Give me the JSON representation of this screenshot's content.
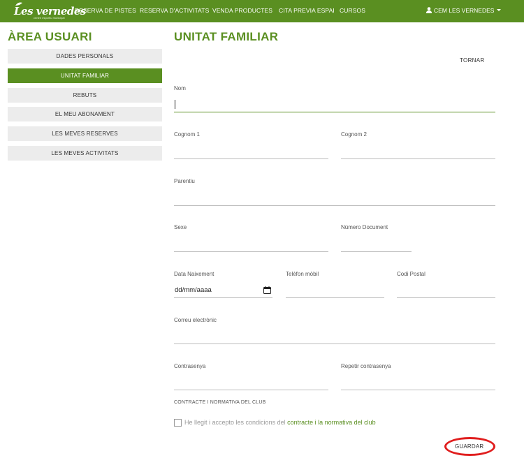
{
  "brand": {
    "name": "Les vernedes",
    "tagline": "centre esportiu municipal"
  },
  "nav": {
    "items": [
      {
        "label": "RESERVA DE PISTES"
      },
      {
        "label": "RESERVA D'ACTIVITATS"
      },
      {
        "label": "VENDA PRODUCTES"
      },
      {
        "label": "CITA PREVIA ESPAI"
      },
      {
        "label": "CURSOS"
      }
    ],
    "user": {
      "label": "CEM LES VERNEDES",
      "icon": "user-icon"
    }
  },
  "sidebar": {
    "title": "ÀREA USUARI",
    "items": [
      {
        "label": "DADES PERSONALS",
        "active": false
      },
      {
        "label": "UNITAT FAMILIAR",
        "active": true
      },
      {
        "label": "REBUTS",
        "active": false
      },
      {
        "label": "EL MEU ABONAMENT",
        "active": false
      },
      {
        "label": "LES MEVES RESERVES",
        "active": false
      },
      {
        "label": "LES MEVES ACTIVITATS",
        "active": false
      }
    ]
  },
  "main": {
    "title": "UNITAT FAMILIAR",
    "back_label": "TORNAR",
    "fields": {
      "nom": {
        "label": "Nom",
        "value": ""
      },
      "cognom1": {
        "label": "Cognom 1",
        "value": ""
      },
      "cognom2": {
        "label": "Cognom 2",
        "value": ""
      },
      "parentiu": {
        "label": "Parentiu",
        "value": ""
      },
      "sexe": {
        "label": "Sexe",
        "value": ""
      },
      "numero_document": {
        "label": "Número Document",
        "value": ""
      },
      "data_naixement": {
        "label": "Data Naixement",
        "placeholder": "dd/mm/aaaa"
      },
      "telefon": {
        "label": "Telèfon mòbil",
        "value": ""
      },
      "codi_postal": {
        "label": "Codi Postal",
        "value": ""
      },
      "correu": {
        "label": "Correu electrònic",
        "value": ""
      },
      "contrasenya": {
        "label": "Contrasenya",
        "value": ""
      },
      "repetir_contrasenya": {
        "label": "Repetir contrasenya",
        "value": ""
      }
    },
    "contract_section": "CONTRACTE I NORMATIVA DEL CLUB",
    "accept": {
      "text": "He llegit i accepto les condicions del",
      "link": "contracte i la normativa del club",
      "checked": false
    },
    "save_label": "GUARDAR"
  },
  "colors": {
    "brand_green": "#5a8f21",
    "highlight_red": "#e01e1e",
    "sidebar_bg": "#ececec"
  }
}
